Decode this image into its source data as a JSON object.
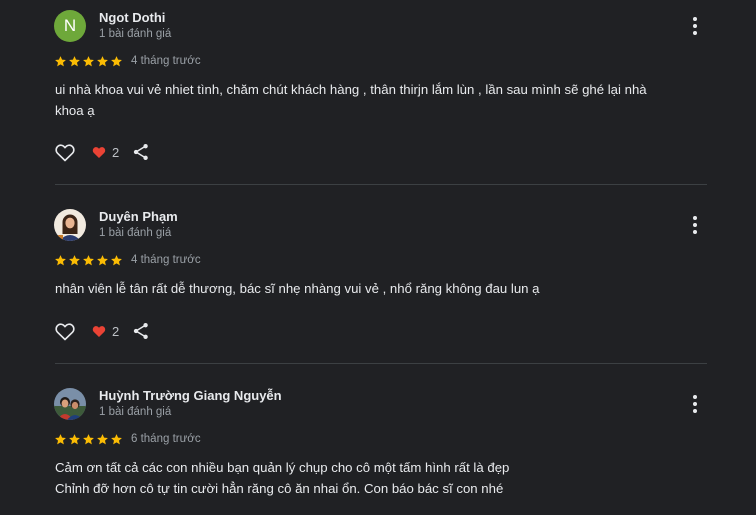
{
  "reviews": [
    {
      "avatar_letter": "N",
      "avatar_color": "#6ea83a",
      "name": "Ngot Dothi",
      "review_count": "1 bài đánh giá",
      "stars": 5,
      "time": "4 tháng trước",
      "text_lines": [
        "ui nhà khoa vui vẻ nhiet tình, chăm chút khách hàng , thân thirjn lắm lùn , lần sau mình sẽ ghé lại nhà",
        "khoa ạ"
      ],
      "reaction_count": "2"
    },
    {
      "avatar_letter": "",
      "name": "Duyên Phạm",
      "review_count": "1 bài đánh giá",
      "stars": 5,
      "time": "4 tháng trước",
      "text_lines": [
        "nhân viên lễ tân rất dễ thương, bác sĩ nhẹ nhàng vui vẻ , nhổ răng không đau lun ạ"
      ],
      "reaction_count": "2"
    },
    {
      "avatar_letter": "",
      "name": "Huỳnh Trường Giang Nguyễn",
      "review_count": "1 bài đánh giá",
      "stars": 5,
      "time": "6 tháng trước",
      "text_lines": [
        "Cảm ơn tất cả các con nhiều bạn quản lý chụp cho cô một tấm hình rất là đẹp",
        "Chỉnh đỡ hơn cô tự tin cười hẳn răng cô ăn nhai ổn. Con báo bác sĩ con nhé"
      ]
    }
  ],
  "colors": {
    "background": "#202124",
    "star": "#fbbc04",
    "heart": "#ea4335",
    "divider": "#3c4043",
    "secondary_text": "#9aa0a6"
  },
  "icons": {
    "more": "more-vert-icon",
    "like": "thumb-heart-outline-icon",
    "reaction": "heart-filled-icon",
    "share": "share-icon"
  }
}
